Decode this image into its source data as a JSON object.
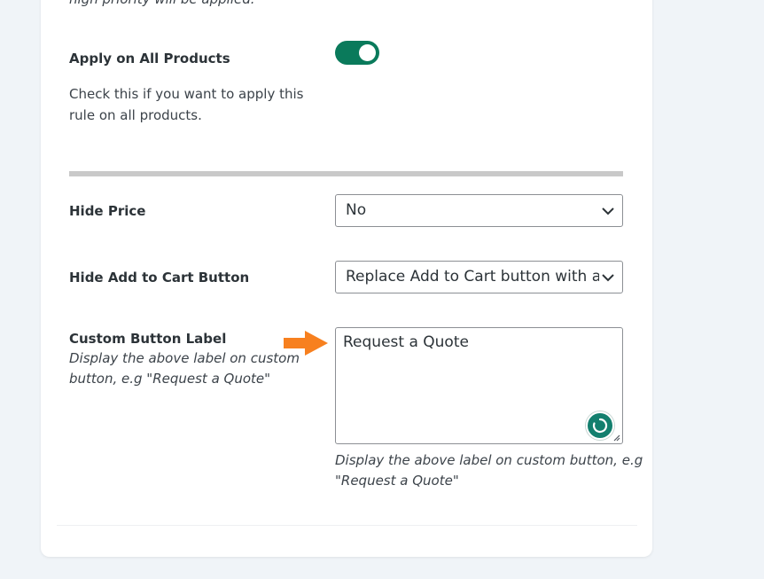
{
  "top_cut_text": "high priority will be applied.",
  "apply_all": {
    "label": "Apply on All Products",
    "description_line1": "Check this if you want to apply this",
    "description_line2": "rule on all products.",
    "toggle_on": true
  },
  "hide_price": {
    "label": "Hide Price",
    "selected": "No"
  },
  "hide_cart": {
    "label": "Hide Add to Cart Button",
    "selected": "Replace Add to Cart button with a Quote"
  },
  "custom_label": {
    "label": "Custom Button Label",
    "help_line1": "Display the above label on custom",
    "help_line2": "button, e.g \"Request a Quote\"",
    "value": "Request a Quote",
    "below_line1": "Display the above label on custom button, e.g",
    "below_line2": "\"Request a Quote\""
  },
  "colors": {
    "toggle": "#0a7a5b",
    "arrow": "#f7801f",
    "assistant": "#137f6e"
  },
  "icons": {
    "arrow": "arrow-right-icon",
    "chevron": "chevron-down-icon",
    "assistant": "writing-assistant-icon",
    "resize": "resize-handle-icon"
  }
}
